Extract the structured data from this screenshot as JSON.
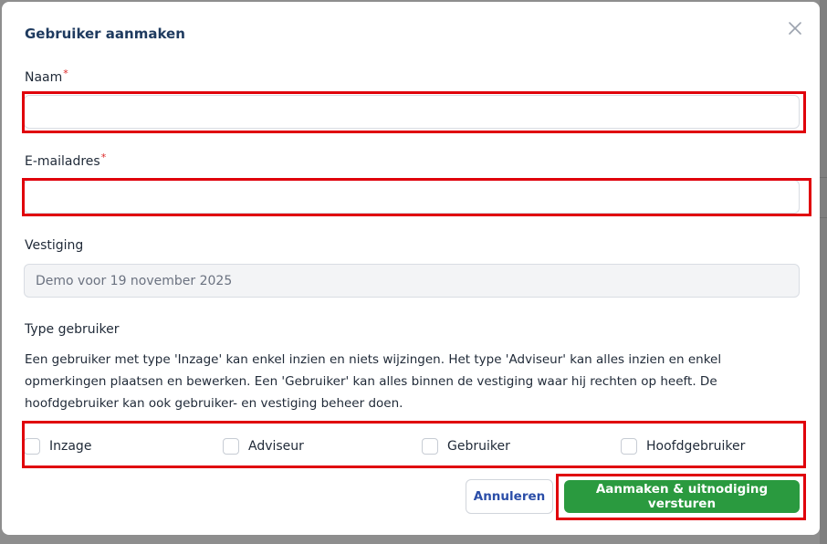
{
  "modal": {
    "title": "Gebruiker aanmaken",
    "close_icon": "close-icon"
  },
  "fields": {
    "naam": {
      "label": "Naam",
      "required_mark": "*",
      "value": "",
      "placeholder": ""
    },
    "email": {
      "label": "E-mailadres",
      "required_mark": "*",
      "value": "",
      "placeholder": ""
    },
    "vestiging": {
      "label": "Vestiging",
      "value": "Demo voor 19 november 2025"
    }
  },
  "type_gebruiker": {
    "label": "Type gebruiker",
    "description": "Een gebruiker met type 'Inzage' kan enkel inzien en niets wijzingen. Het type 'Adviseur' kan alles inzien en enkel opmerkingen plaatsen en bewerken. Een 'Gebruiker' kan alles binnen de vestiging waar hij rechten op heeft. De hoofdgebruiker kan ook gebruiker- en vestiging beheer doen.",
    "options": [
      {
        "label": "Inzage",
        "checked": false
      },
      {
        "label": "Adviseur",
        "checked": false
      },
      {
        "label": "Gebruiker",
        "checked": false
      },
      {
        "label": "Hoofdgebruiker",
        "checked": false
      }
    ]
  },
  "actions": {
    "cancel_label": "Annuleren",
    "submit_label": "Aanmaken & uitnodiging versturen"
  },
  "colors": {
    "title": "#1e3a5f",
    "required": "#dc2626",
    "submit_bg": "#2a9a3f",
    "cancel_text": "#2b4ea8",
    "highlight": "#e0000b"
  }
}
